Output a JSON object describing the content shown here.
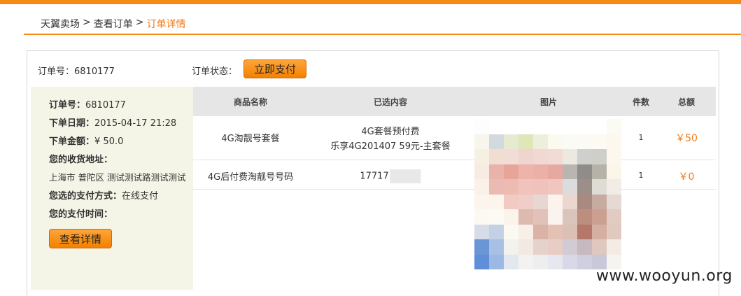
{
  "breadcrumb": {
    "home": "天翼卖场",
    "separator1": ">",
    "orders": "查看订单",
    "separator2": ">",
    "current": "订单详情"
  },
  "order_header": {
    "order_no_label": "订单号：6810177",
    "status_label": "订单状态：",
    "pay_button": "立即支付"
  },
  "order_info": {
    "order_no": {
      "label": "订单号：",
      "value": "6810177"
    },
    "order_date": {
      "label": "下单日期：",
      "value": "2015-04-17 21:28"
    },
    "order_amount": {
      "label": "下单金额：",
      "value": "¥ 50.0"
    },
    "address_label": "您的收货地址：",
    "address_value": "上海市 普陀区 测试测试路测试测试",
    "payment_method": {
      "label": "您选的支付方式：",
      "value": "在线支付"
    },
    "payment_time_label": "您的支付时间：",
    "detail_button": "查看详情"
  },
  "table": {
    "headers": [
      "商品名称",
      "已选内容",
      "图片",
      "件数",
      "总额"
    ],
    "rows": [
      {
        "name": "4G淘靓号套餐",
        "content_line1": "4G套餐预付费",
        "content_line2": "乐享4G201407 59元-主套餐",
        "qty": "1",
        "total": "￥50"
      },
      {
        "name": "4G后付费淘靓号号码",
        "content_line1": "17717",
        "qty": "1",
        "total": "￥0"
      }
    ]
  },
  "mosaic_colors": [
    "#fdfdfd",
    "#ffffff",
    "#ffffff",
    "#ffffff",
    "#ffffff",
    "#ffffff",
    "#ffffff",
    "#ffffff",
    "#ffffff",
    "#fbfbf4",
    "#f7f5ec",
    "#d3dadf",
    "#e6ead1",
    "#dfe6b8",
    "#eeeedd",
    "#fafaf0",
    "#fbfbf5",
    "#fcfaf4",
    "#fcfaf2",
    "#fcf8ee",
    "#f6f0e2",
    "#f1ddd2",
    "#f2dcd6",
    "#f0d4cf",
    "#f1d8d2",
    "#f1dcd5",
    "#ebe9e0",
    "#cfcfcd",
    "#cfcfc9",
    "#fcf8ef",
    "#f8ece2",
    "#e8b3a8",
    "#e7a59a",
    "#eeb4aa",
    "#eab1a8",
    "#e7a89f",
    "#b9b6b2",
    "#8f8c89",
    "#b7b2a8",
    "#fcf6ea",
    "#faf1e8",
    "#ebbab2",
    "#eebbb3",
    "#f0c4bc",
    "#efc3bc",
    "#f0c6bf",
    "#dcdcdc",
    "#9c8e88",
    "#dfdcd6",
    "#f1ece6",
    "#fbf5ec",
    "#fcf5ec",
    "#f0cac3",
    "#f1cdc7",
    "#e8d6d2",
    "#fbf3ec",
    "#ecd7cf",
    "#a88a80",
    "#c7aba0",
    "#e6d9d3",
    "#fcf9f2",
    "#fdf9f3",
    "#fbf4ed",
    "#dcbab0",
    "#e2c2b8",
    "#fbf4ee",
    "#dac4bc",
    "#bc8e80",
    "#cca090",
    "#e2cbc0",
    "#d7dde8",
    "#c4d0e3",
    "#fcf8f2",
    "#f7efe8",
    "#d9b3a6",
    "#e5c1b5",
    "#dbc0b6",
    "#b4776a",
    "#d5b0a2",
    "#e0c9bf",
    "#6b96d6",
    "#a8c0e4",
    "#f3f2ee",
    "#f1e9e2",
    "#e5d2ca",
    "#e7cdc4",
    "#d2cbd3",
    "#c8b8c0",
    "#e0c8bf",
    "#f3ebe4",
    "#5f8fd8",
    "#9cb8e4",
    "#e3e7ee",
    "#f3f2f0",
    "#eeeeee",
    "#e7e7f0",
    "#d8d8e8",
    "#cfcfe0",
    "#c8c8d8",
    "#f6f4f0"
  ],
  "watermark": "www.wooyun.org"
}
